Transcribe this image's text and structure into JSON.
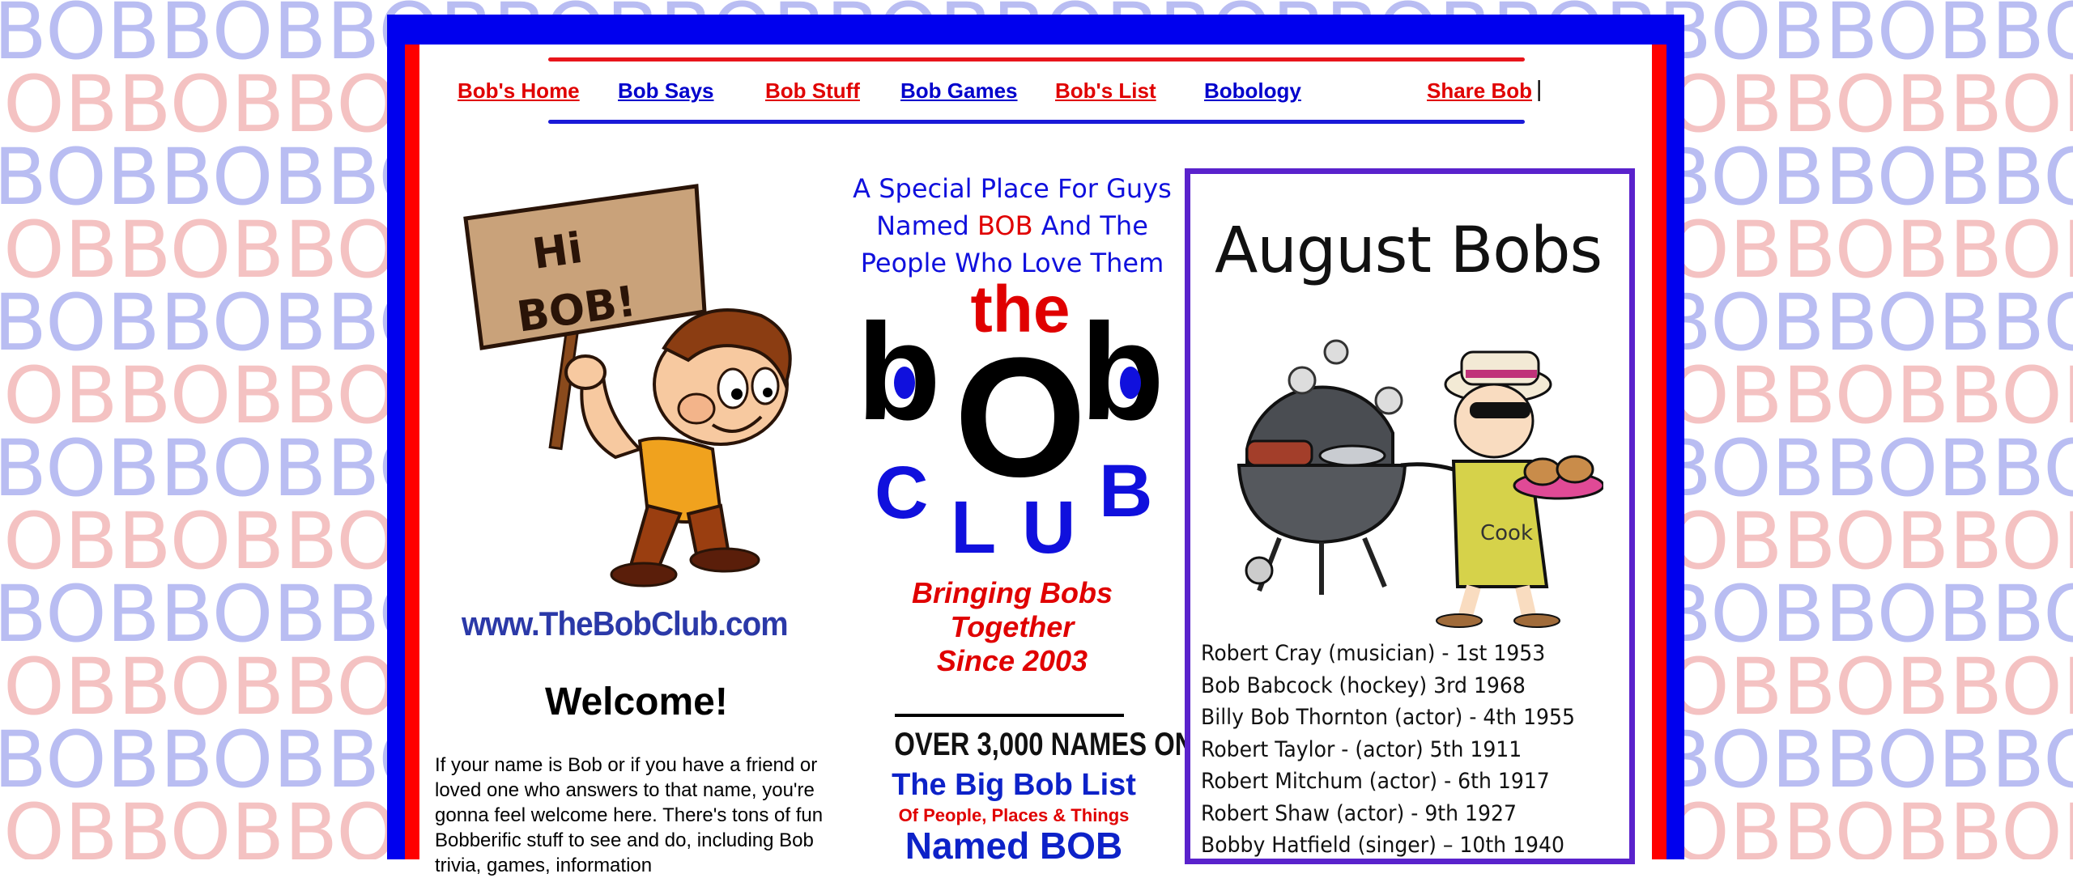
{
  "background": {
    "pattern_word": "BOB",
    "colors": {
      "blue": "#b9bdf2",
      "red": "#f4c2c2"
    }
  },
  "colors": {
    "frame_blue": "#0000ee",
    "frame_red": "#ff0000",
    "nav_red": "#e00000",
    "nav_blue": "#0000cc"
  },
  "nav": {
    "items": [
      {
        "label": "Bob's Home",
        "color": "red"
      },
      {
        "label": "Bob Says",
        "color": "blue"
      },
      {
        "label": "Bob Stuff",
        "color": "red"
      },
      {
        "label": "Bob Games",
        "color": "blue"
      },
      {
        "label": "Bob's List",
        "color": "red"
      },
      {
        "label": "Bobology",
        "color": "blue"
      }
    ],
    "share": "Share Bob",
    "separator": "|"
  },
  "left": {
    "sign_line1": "Hi",
    "sign_line2": "BOB!",
    "site_url": "www.TheBobClub.com",
    "welcome": "Welcome!",
    "intro": "If your name is Bob or if you have a friend or loved one who answers to that name, you're gonna feel welcome here. There's tons of fun Bobberific stuff to see and do, including Bob trivia, games, information"
  },
  "middle": {
    "tagline_part1": "A Special Place For Guys Named",
    "tagline_bob": "BOB",
    "tagline_part2": "And The People Who Love Them",
    "logo": {
      "the": "the",
      "b1": "b",
      "o": "O",
      "b2": "b",
      "c": "C",
      "l": "L",
      "u": "U",
      "b3": "B"
    },
    "since_line1": "Bringing Bobs",
    "since_line2": "Together",
    "since_line3": "Since 2003",
    "banner_line1": "OVER 3,000 NAMES ON",
    "banner_line2": "The Big Bob List",
    "banner_line3": "Of People, Places & Things",
    "banner_line4": "Named BOB"
  },
  "right": {
    "title": "August Bobs",
    "apron_label": "Cook",
    "birthdays": [
      "Robert Cray (musician) - 1st 1953",
      "Bob Babcock (hockey) 3rd 1968",
      "Billy Bob Thornton (actor) - 4th 1955",
      "Robert Taylor - (actor) 5th 1911",
      "Robert Mitchum (actor) - 6th 1917",
      "Robert Shaw (actor) - 9th 1927",
      "Bobby Hatfield (singer) – 10th 1940"
    ]
  }
}
